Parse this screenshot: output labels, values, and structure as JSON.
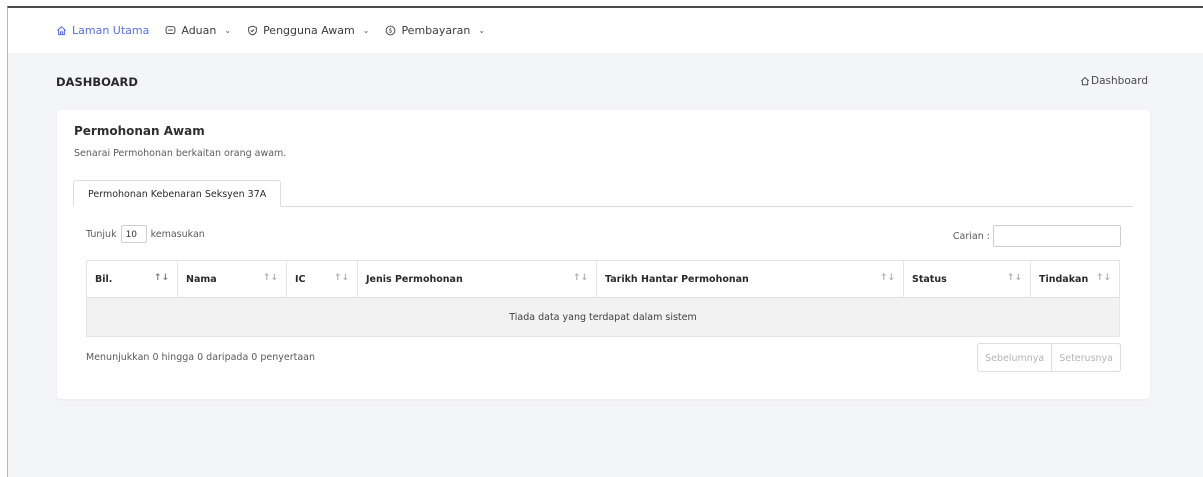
{
  "nav": {
    "items": [
      {
        "label": "Laman Utama",
        "icon": "home-icon",
        "has_dropdown": false,
        "active": true
      },
      {
        "label": "Aduan",
        "icon": "message-icon",
        "has_dropdown": true,
        "active": false
      },
      {
        "label": "Pengguna Awam",
        "icon": "shield-icon",
        "has_dropdown": true,
        "active": false
      },
      {
        "label": "Pembayaran",
        "icon": "coin-icon",
        "has_dropdown": true,
        "active": false
      }
    ],
    "active_color": "#5a6ee8"
  },
  "page": {
    "title": "DASHBOARD",
    "breadcrumb": "Dashboard"
  },
  "card": {
    "title": "Permohonan Awam",
    "subtitle": "Senarai Permohonan berkaitan orang awam.",
    "tab": "Permohonan Kebenaran Seksyen 37A"
  },
  "table_controls": {
    "show_prefix": "Tunjuk",
    "show_value": "10",
    "show_suffix": "kemasukan",
    "search_label": "Carian :"
  },
  "table": {
    "columns": [
      "Bil.",
      "Nama",
      "IC",
      "Jenis Permohonan",
      "Tarikh Hantar Permohonan",
      "Status",
      "Tindakan"
    ],
    "empty_message": "Tiada data yang terdapat dalam sistem"
  },
  "footer": {
    "info": "Menunjukkan 0 hingga 0 daripada 0 penyertaan",
    "prev": "Sebelumnya",
    "next": "Seterusnya"
  }
}
